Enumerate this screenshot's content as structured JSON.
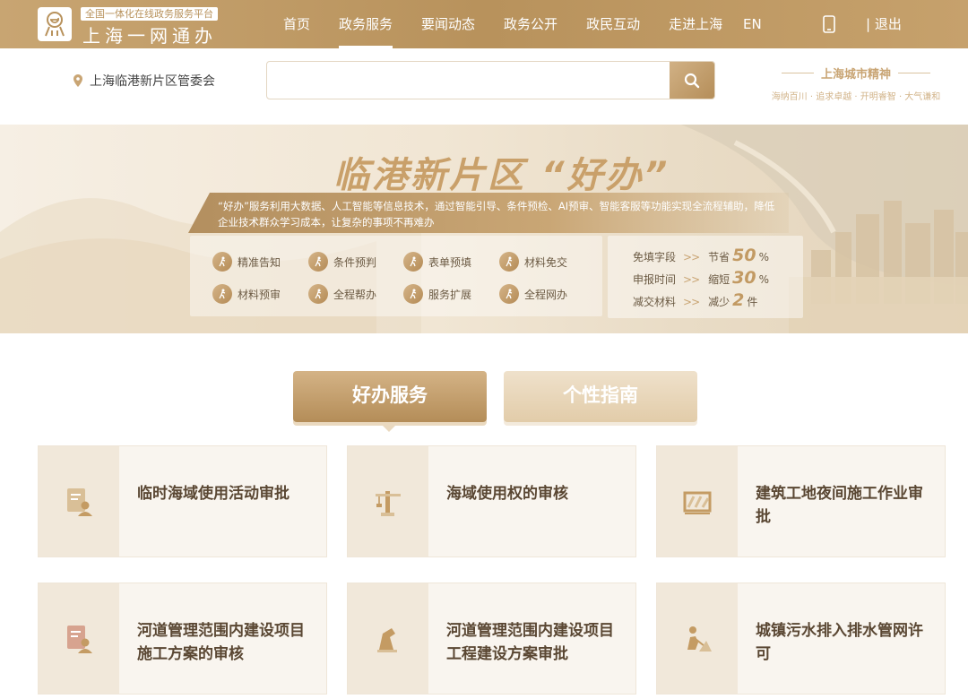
{
  "header": {
    "logo_tag": "全国一体化在线政务服务平台",
    "logo_name": "上海一网通办",
    "nav": [
      {
        "label": "首页",
        "active": false
      },
      {
        "label": "政务服务",
        "active": true
      },
      {
        "label": "要闻动态",
        "active": false
      },
      {
        "label": "政务公开",
        "active": false
      },
      {
        "label": "政民互动",
        "active": false
      },
      {
        "label": "走进上海",
        "active": false
      }
    ],
    "lang": "EN",
    "logout": "| 退出"
  },
  "search": {
    "location": "上海临港新片区管委会",
    "placeholder": "",
    "value": ""
  },
  "spirit": {
    "title": "上海城市精神",
    "subtitle": "海纳百川 · 追求卓越 · 开明睿智 · 大气谦和"
  },
  "banner": {
    "title": "临港新片区  “好办”",
    "description": "“好办”服务利用大数据、人工智能等信息技术，通过智能引导、条件预检、AI预审、智能客服等功能实现全流程辅助，降低企业技术群众学习成本，让复杂的事项不再难办",
    "features": [
      "精准告知",
      "条件预判",
      "表单预填",
      "材料免交",
      "材料预审",
      "全程帮办",
      "服务扩展",
      "全程网办"
    ],
    "stats": [
      {
        "label": "免填字段",
        "action": "节省",
        "value": "50",
        "unit": "%"
      },
      {
        "label": "申报时间",
        "action": "缩短",
        "value": "30",
        "unit": "%"
      },
      {
        "label": "减交材料",
        "action": "减少",
        "value": "2",
        "unit": "件"
      }
    ]
  },
  "tabs": [
    {
      "label": "好办服务",
      "active": true
    },
    {
      "label": "个性指南",
      "active": false
    }
  ],
  "cards": [
    {
      "title": "临时海域使用活动审批",
      "icon": "document-person-icon"
    },
    {
      "title": "海域使用权的审核",
      "icon": "crane-icon"
    },
    {
      "title": "建筑工地夜间施工作业审批",
      "icon": "barrier-icon"
    },
    {
      "title": "河道管理范围内建设项目施工方案的审核",
      "icon": "document-person-icon"
    },
    {
      "title": "河道管理范围内建设项目工程建设方案审批",
      "icon": "excavator-icon"
    },
    {
      "title": "城镇污水排入排水管网许可",
      "icon": "worker-icon"
    }
  ],
  "colors": {
    "brand": "#b8925c",
    "accent_light": "#f1e8da",
    "text_dark": "#5a4733"
  }
}
